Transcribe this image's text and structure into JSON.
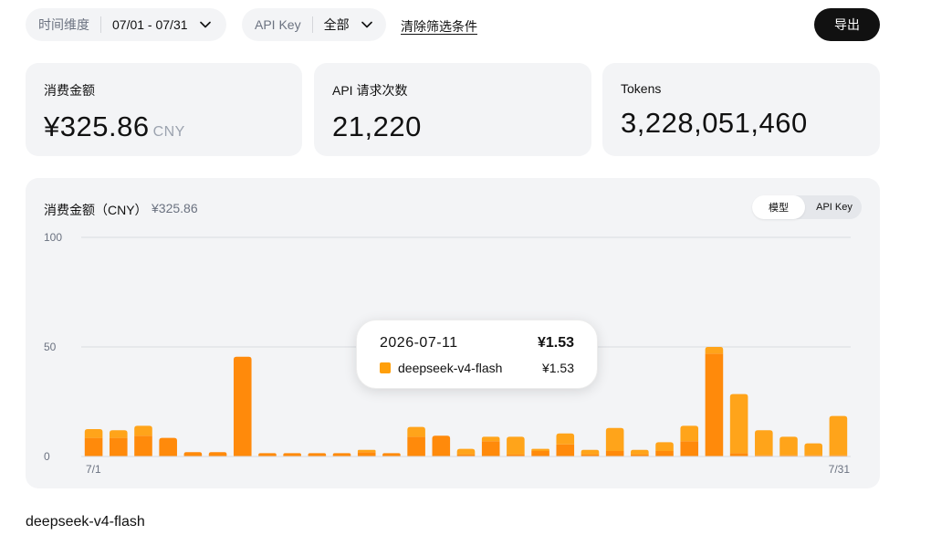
{
  "filters": {
    "time_label": "时间维度",
    "time_value": "07/01 - 07/31",
    "key_label": "API Key",
    "key_value": "全部",
    "clear_label": "清除筛选条件",
    "export_label": "导出"
  },
  "cards": [
    {
      "title": "消费金额",
      "value": "¥325.86",
      "unit": "CNY"
    },
    {
      "title": "API 请求次数",
      "value": "21,220"
    },
    {
      "title": "Tokens",
      "value": "3,228,051,460"
    }
  ],
  "chart": {
    "title": "消费金额（CNY）",
    "total": "¥325.86",
    "toggle": {
      "active": "模型",
      "inactive": "API Key"
    }
  },
  "tooltip": {
    "date": "2026-07-11",
    "total": "¥1.53",
    "model": "deepseek-v4-flash",
    "value": "¥1.53"
  },
  "section_title": "deepseek-v4-flash",
  "colors": {
    "series_dark": "#ff8a0b",
    "series_light": "#ffa41a",
    "text": "#111111"
  },
  "chart_data": {
    "type": "bar",
    "stacked": true,
    "categories": [
      "7/1",
      "7/2",
      "7/3",
      "7/4",
      "7/5",
      "7/6",
      "7/7",
      "7/8",
      "7/9",
      "7/10",
      "7/11",
      "7/12",
      "7/13",
      "7/14",
      "7/15",
      "7/16",
      "7/17",
      "7/18",
      "7/19",
      "7/20",
      "7/21",
      "7/22",
      "7/23",
      "7/24",
      "7/25",
      "7/26",
      "7/27",
      "7/28",
      "7/29",
      "7/30",
      "7/31"
    ],
    "x_tick_labels": [
      "7/1",
      "7/31"
    ],
    "y_ticks": [
      0,
      50,
      100
    ],
    "ylim": [
      0,
      100
    ],
    "grid": true,
    "series": [
      {
        "values": [
          8.5,
          8.5,
          9.5,
          8.5,
          2,
          2,
          45.5,
          1.5,
          1.5,
          1.5,
          1.5,
          2,
          1.5,
          9,
          9.5,
          1,
          7,
          1,
          2.5,
          5.5,
          1,
          2.5,
          1,
          2.5,
          7,
          47,
          1.5,
          0.5,
          0.5,
          0.5,
          0.5
        ]
      },
      {
        "values": [
          4,
          3.5,
          4.5,
          0,
          0,
          0,
          0,
          0,
          0,
          0,
          0,
          1,
          0,
          4.5,
          0,
          2.5,
          2,
          8,
          1,
          5,
          2,
          10.5,
          2,
          4,
          7,
          3,
          27,
          11.5,
          8.5,
          5.5,
          18
        ]
      }
    ]
  }
}
